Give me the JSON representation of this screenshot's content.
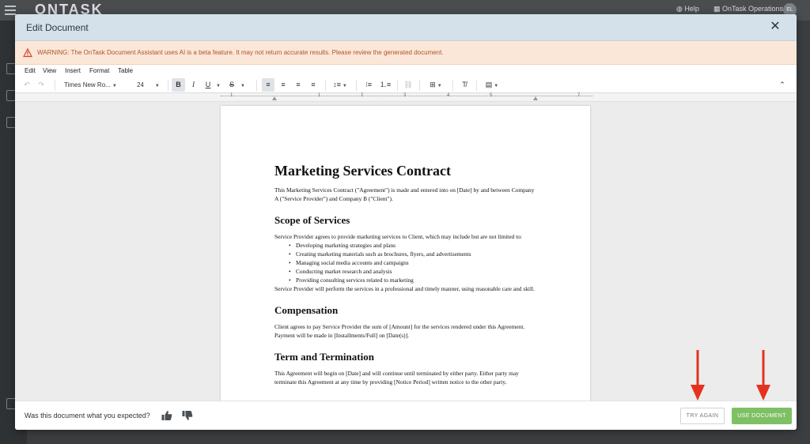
{
  "app": {
    "logo": "ONTASK",
    "help_label": "Help",
    "org_label": "OnTask Operations",
    "avatar_initials": "EL"
  },
  "modal": {
    "title": "Edit Document",
    "close_icon": "close-icon"
  },
  "warning": {
    "text": "WARNING: The OnTask Document Assistant uses AI is a beta feature. It may not return accurate results. Please review the generated document.",
    "icon": "warning-triangle-icon",
    "color": "#b0532a"
  },
  "menubar": {
    "items": [
      "Edit",
      "View",
      "Insert",
      "Format",
      "Table"
    ]
  },
  "toolbar": {
    "font_family": "Times New Ro...",
    "font_size": "24",
    "bold": "B",
    "italic": "I",
    "underline": "U",
    "strike": "S"
  },
  "ruler": {
    "numbers": [
      "1",
      "1",
      "2",
      "3",
      "4",
      "5",
      "6",
      "7"
    ]
  },
  "document": {
    "title": "Marketing Services Contract",
    "intro": "This Marketing Services Contract (\"Agreement\") is made and entered into on [Date] by and between Company A (\"Service Provider\") and Company B (\"Client\").",
    "scope_heading": "Scope of Services",
    "scope_intro": "Service Provider agrees to provide marketing services to Client, which may include but are not limited to:",
    "scope_items": [
      "Developing marketing strategies and plans",
      "Creating marketing materials such as brochures, flyers, and advertisements",
      "Managing social media accounts and campaigns",
      "Conducting market research and analysis",
      "Providing consulting services related to marketing"
    ],
    "scope_outro": "Service Provider will perform the services in a professional and timely manner, using reasonable care and skill.",
    "comp_heading": "Compensation",
    "comp_text": "Client agrees to pay Service Provider the sum of [Amount] for the services rendered under this Agreement. Payment will be made in [Installments/Full] on [Date(s)].",
    "term_heading": "Term and Termination",
    "term_text": "This Agreement will begin on [Date] and will continue until terminated by either party. Either party may terminate this Agreement at any time by providing [Notice Period] written notice to the other party."
  },
  "footer": {
    "question": "Was this document what you expected?",
    "try_again": "TRY AGAIN",
    "use_document": "USE DOCUMENT"
  },
  "colors": {
    "accent_green": "#7fc064",
    "header_bg": "#d5e1ea",
    "warning_bg": "#fbe7d8",
    "annotation_red": "#e5321f"
  }
}
